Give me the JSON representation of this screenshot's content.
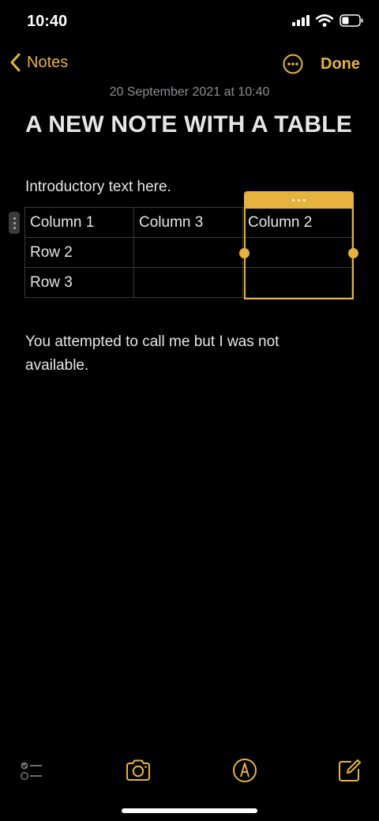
{
  "status_bar": {
    "time": "10:40"
  },
  "nav": {
    "back_label": "Notes",
    "done_label": "Done"
  },
  "note": {
    "date": "20 September 2021 at 10:40",
    "title": "A NEW NOTE WITH A TABLE",
    "intro": "Introductory text here.",
    "table": [
      [
        "Column 1",
        "Column 3",
        "Column 2"
      ],
      [
        "Row 2",
        "",
        ""
      ],
      [
        "Row 3",
        "",
        ""
      ]
    ],
    "selected_column": 3,
    "body": "You attempted to call me but I was not available."
  },
  "toolbar": {
    "items": [
      "checklist-icon",
      "camera-icon",
      "markup-pen-icon",
      "compose-icon"
    ]
  },
  "colors": {
    "accent": "#e5b33e",
    "background": "#000000",
    "text": "#e6e6e6",
    "secondary_text": "#8e8e93",
    "table_border": "#3a3a3c"
  }
}
